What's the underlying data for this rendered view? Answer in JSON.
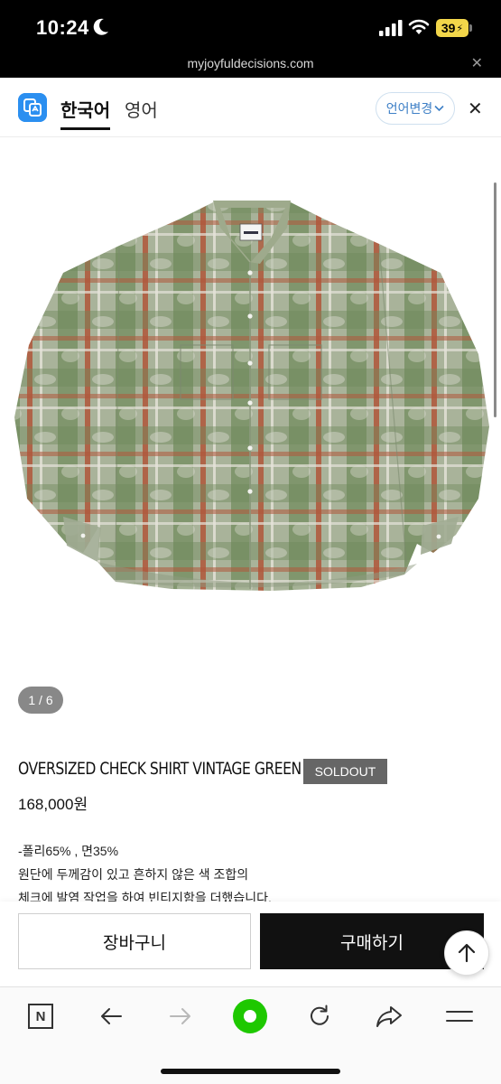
{
  "status": {
    "time": "10:24",
    "battery": "39"
  },
  "browser": {
    "url": "myjoyfuldecisions.com",
    "close_label": "✕"
  },
  "translate": {
    "lang_source": "한국어",
    "lang_target": "영어",
    "change_label": "언어변경",
    "close_label": "✕"
  },
  "gallery": {
    "counter": "1 / 6"
  },
  "product": {
    "name": "OVERSIZED CHECK SHIRT VINTAGE GREEN",
    "badge": "SOLDOUT",
    "price": "168,000원",
    "description": [
      "-폴리65% , 면35%",
      "원단에 두께감이 있고 흔하지 않은 색 조합의",
      "체크에 발염 작업을 하여 빈티지함을 더했습니다."
    ]
  },
  "actions": {
    "cart_label": "장바구니",
    "buy_label": "구매하기"
  },
  "toolbar": {
    "home_label": "N"
  },
  "colors": {
    "accent_blue": "#3d7fc6",
    "logo_blue": "#2b8ff0",
    "status_yellow": "#f2d64a",
    "home_green": "#1ec800",
    "shirt_green": "#6f8a5a",
    "shirt_red": "#b0563a"
  }
}
